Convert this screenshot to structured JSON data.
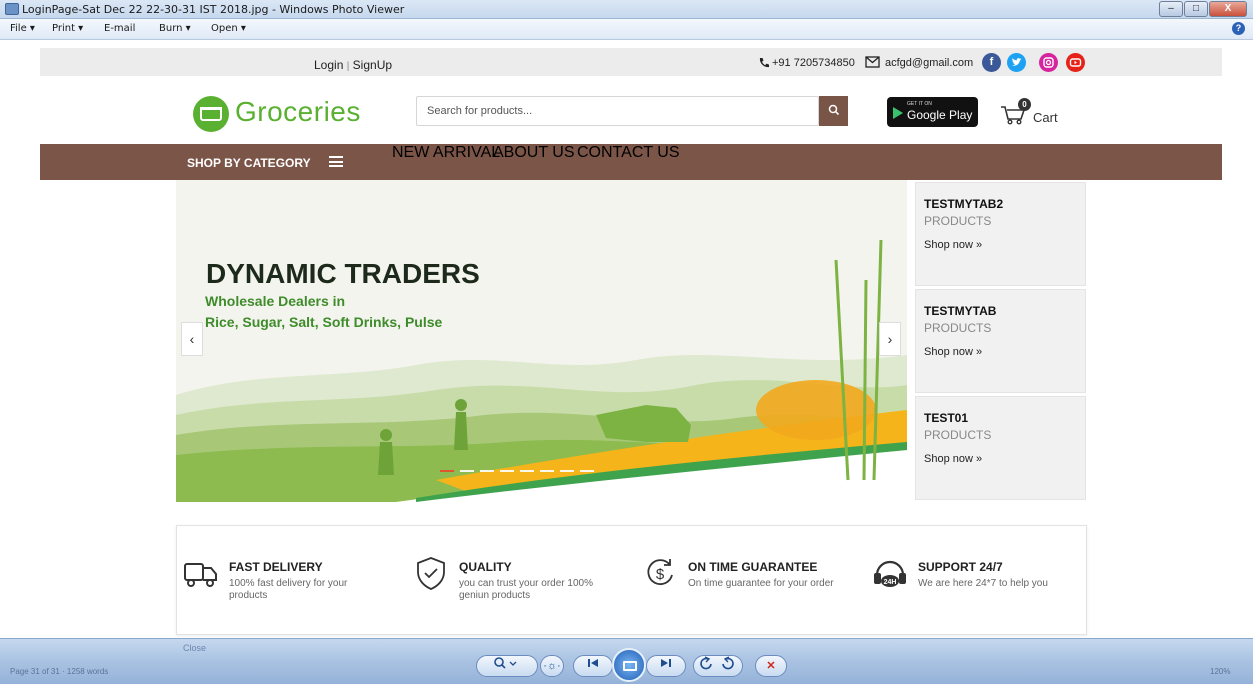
{
  "window": {
    "title": "LoginPage-Sat Dec 22 22-30-31 IST 2018.jpg - Windows Photo Viewer",
    "buttons": {
      "minimize": "–",
      "maximize": "□",
      "close": "X"
    }
  },
  "menu": {
    "file": "File ▾",
    "print": "Print ▾",
    "email": "E-mail",
    "burn": "Burn ▾",
    "open": "Open ▾",
    "help": "?"
  },
  "header": {
    "login": "Login",
    "separator": "|",
    "signup": "SignUp",
    "phone": "+91 7205734850",
    "email": "acfgd@gmail.com",
    "social": [
      "facebook-icon",
      "twitter-icon",
      "instagram-icon",
      "youtube-icon"
    ],
    "social_colors": [
      "#3b5998",
      "#1da1f2",
      "#d6249f",
      "#e62117"
    ]
  },
  "brand": {
    "logo_text": "Groceries",
    "accent": "#5ab031"
  },
  "search": {
    "placeholder": "Search for products..."
  },
  "appstore": {
    "small": "GET IT ON",
    "big": "Google Play"
  },
  "cart": {
    "count": "0",
    "label": "Cart"
  },
  "nav": {
    "category": "SHOP BY CATEGORY",
    "items": [
      "NEW ARRIVAL",
      "ABOUT US",
      "CONTACT US"
    ],
    "color": "#7a5548"
  },
  "banner": {
    "title": "DYNAMIC TRADERS",
    "line1": "Wholesale Dealers in",
    "line2": "Rice, Sugar, Salt, Soft Drinks, Pulse",
    "prev": "‹",
    "next": "›"
  },
  "side_cards": [
    {
      "name": "TESTMYTAB2",
      "sub": "PRODUCTS",
      "link": "Shop now »"
    },
    {
      "name": "TESTMYTAB",
      "sub": "PRODUCTS",
      "link": "Shop now »"
    },
    {
      "name": "TEST01",
      "sub": "PRODUCTS",
      "link": "Shop now »"
    }
  ],
  "features": [
    {
      "title": "FAST DELIVERY",
      "desc": "100% fast delivery for your products",
      "icon": "truck-icon"
    },
    {
      "title": "QUALITY",
      "desc": "you can trust your order 100% geniun products",
      "icon": "shield-check-icon"
    },
    {
      "title": "ON TIME GUARANTEE",
      "desc": "On time guarantee for your order",
      "icon": "dollar-cycle-icon"
    },
    {
      "title": "SUPPORT 24/7",
      "desc": "We are here 24*7 to help you",
      "icon": "headset-24h-icon"
    }
  ],
  "viewer_bar": {
    "close_label": "Close",
    "status_left": "Page 31 of 31 · 1258 words",
    "status_right": "120%"
  }
}
